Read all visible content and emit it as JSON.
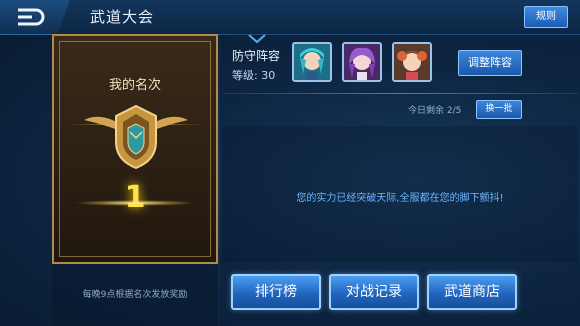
{
  "header": {
    "title": "武道大会",
    "rules_label": "规则"
  },
  "rank": {
    "label": "我的名次",
    "number": "1",
    "reward_note": "每晚9点根据名次发放奖励"
  },
  "lineup": {
    "title": "防守阵容",
    "level_label": "等级:",
    "level_value": "30",
    "adjust_label": "调整阵容",
    "heroes": [
      "hero-portrait-1",
      "hero-portrait-2",
      "hero-portrait-3"
    ]
  },
  "opponents": {
    "remaining_label": "今日剩余",
    "remaining_value": "2/5",
    "refresh_label": "换一批",
    "message": "您的实力已经突破天际,全服都在您的脚下颤抖!"
  },
  "actions": {
    "leaderboard": "排行榜",
    "battle_log": "对战记录",
    "shop": "武道商店"
  },
  "colors": {
    "accent_blue": "#2166c0",
    "gold": "#ffe14a",
    "message_blue": "#6fb6ff"
  }
}
